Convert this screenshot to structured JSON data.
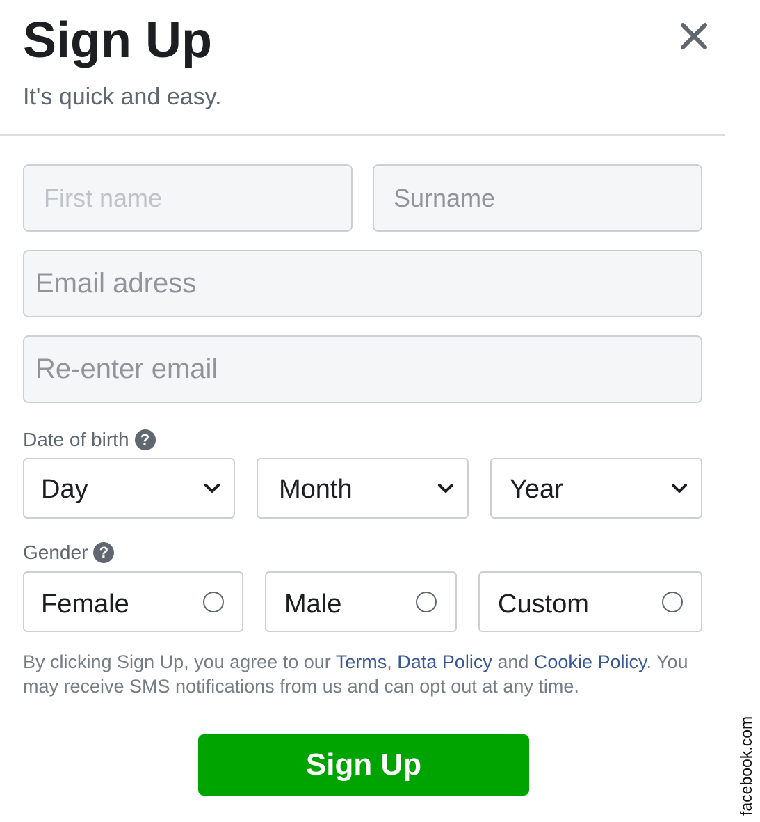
{
  "header": {
    "title": "Sign Up",
    "subtitle": "It's quick and easy.",
    "close_icon": "close-icon"
  },
  "form": {
    "first_name_placeholder": "First name",
    "surname_placeholder": "Surname",
    "email_placeholder": "Email adress",
    "reenter_email_placeholder": "Re-enter email",
    "dob": {
      "label": "Date of birth",
      "help_icon": "?",
      "day": "Day",
      "month": "Month",
      "year": "Year"
    },
    "gender": {
      "label": "Gender",
      "help_icon": "?",
      "options": [
        "Female",
        "Male",
        "Custom"
      ]
    },
    "legal": {
      "prefix": "By clicking Sign Up, you agree to our ",
      "terms": "Terms",
      "comma": ", ",
      "data_policy": "Data Policy",
      "and": " and ",
      "cookie_policy": "Cookie Policy",
      "suffix": ". You may receive SMS notifications from us and can opt out at any time."
    },
    "submit_label": "Sign Up"
  },
  "watermark": "facebook.com",
  "colors": {
    "primary_button": "#00a400",
    "link": "#385898",
    "input_bg": "#f5f6f7",
    "border": "#ccd0d5"
  }
}
